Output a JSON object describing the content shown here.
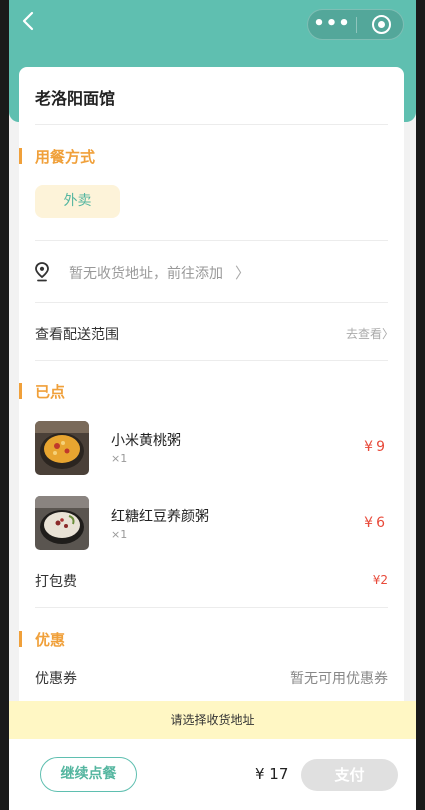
{
  "nav": {
    "back_icon": "chevron-left-icon",
    "more_label": "•••",
    "target_icon": "target-icon"
  },
  "shop": {
    "name": "老洛阳面馆"
  },
  "dining": {
    "title": "用餐方式",
    "mode": "外卖"
  },
  "address": {
    "text": "暂无收货地址，前往添加",
    "chevron": "〉",
    "icon": "location-pin-icon"
  },
  "delivery": {
    "label": "查看配送范围",
    "link": "去查看〉"
  },
  "ordered": {
    "title": "已点",
    "items": [
      {
        "name": "小米黄桃粥",
        "qty": "×1",
        "price": "¥9"
      },
      {
        "name": "红糖红豆养颜粥",
        "qty": "×1",
        "price": "¥6"
      }
    ],
    "packing_label": "打包费",
    "packing_price": "¥2"
  },
  "discount": {
    "title": "优惠",
    "coupon_label": "优惠券",
    "coupon_value": "暂无可用优惠券"
  },
  "notice": "请选择收货地址",
  "footer": {
    "continue_label": "继续点餐",
    "total": "¥ 17",
    "pay_label": "支付"
  },
  "colors": {
    "header": "#5fbfb0",
    "accent": "#f0a03a",
    "price": "#e84a3a",
    "notice_bg": "#fff7c4"
  }
}
